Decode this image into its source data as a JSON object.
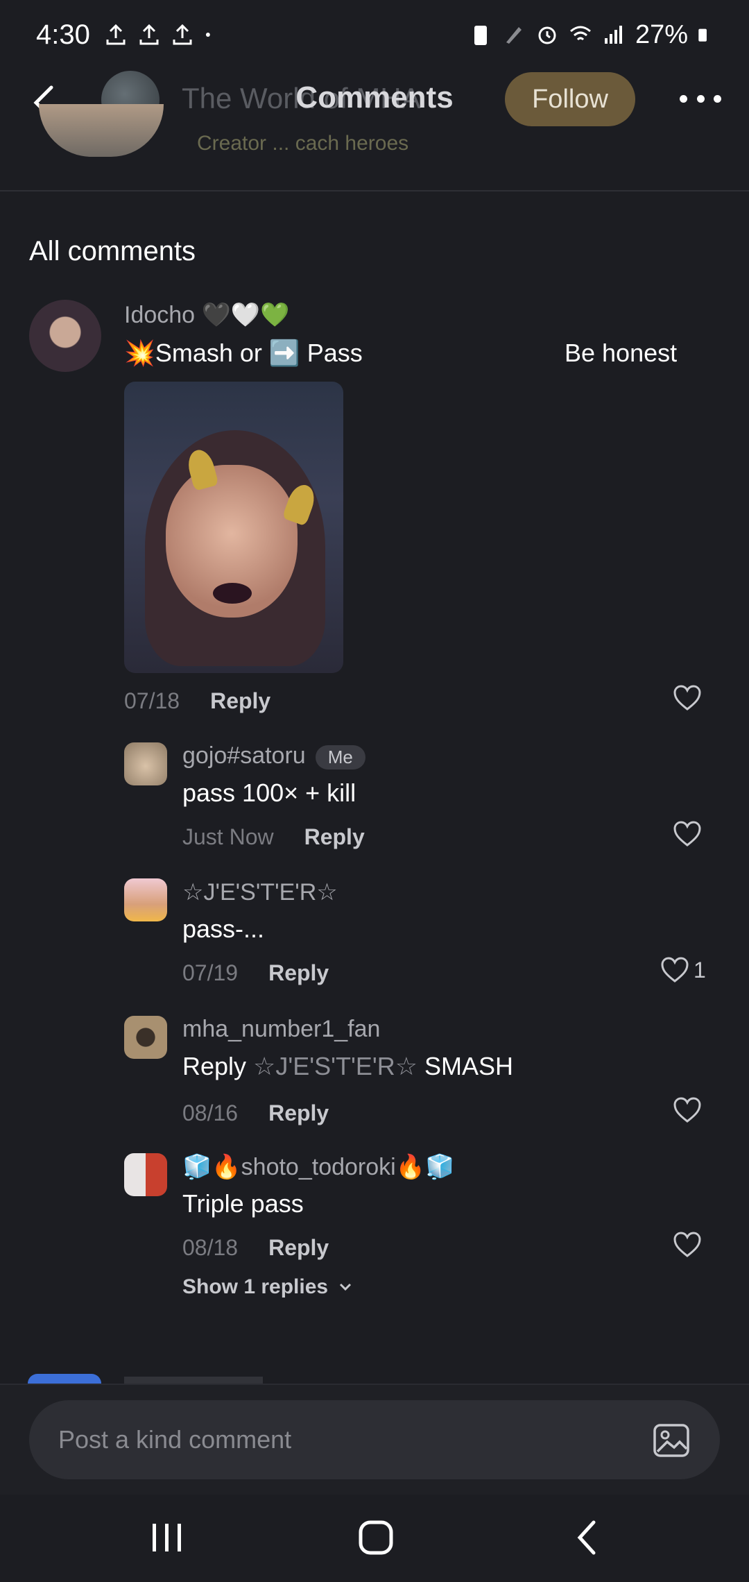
{
  "status_bar": {
    "time": "4:30",
    "battery": "27%"
  },
  "header": {
    "title": "Comments",
    "ghost_title": "The World of MHA",
    "follow_label": "Follow",
    "cutoff_text": "Creator ... cach heroes"
  },
  "section_title": "All comments",
  "main_comment": {
    "username": "Idocho 🖤🤍💚",
    "text": "💥Smash or ➡️ Pass",
    "side_text": "Be honest",
    "date": "07/18",
    "reply_label": "Reply"
  },
  "replies": [
    {
      "username": "gojo#satoru",
      "badge": "Me",
      "text": "pass 100× + kill",
      "date": "Just Now",
      "reply_label": "Reply",
      "likes": ""
    },
    {
      "username": "☆J'E'S'T'E'R☆",
      "text": "pass-...",
      "date": "07/19",
      "reply_label": "Reply",
      "likes": "1"
    },
    {
      "username": "mha_number1_fan",
      "text_prefix": "Reply ",
      "mention": "☆J'E'S'T'E'R☆",
      "text_suffix": " SMASH",
      "date": "08/16",
      "reply_label": "Reply",
      "likes": ""
    },
    {
      "username": "🧊🔥shoto_todoroki🔥🧊",
      "text": "Triple pass",
      "date": "08/18",
      "reply_label": "Reply",
      "likes": ""
    }
  ],
  "show_replies_label": "Show 1 replies",
  "input": {
    "placeholder": "Post a kind comment"
  },
  "colors": {
    "background": "#1c1d22",
    "follow_button": "#6b5a3a",
    "input_bg": "#2d2e34"
  },
  "icons": [
    "upload-icon",
    "alarm-icon",
    "wifi-icon",
    "signal-icon",
    "battery-icon",
    "back-arrow-icon",
    "more-icon",
    "heart-icon",
    "chevron-down-icon",
    "image-icon",
    "nav-recents-icon",
    "nav-home-icon",
    "nav-back-icon"
  ]
}
